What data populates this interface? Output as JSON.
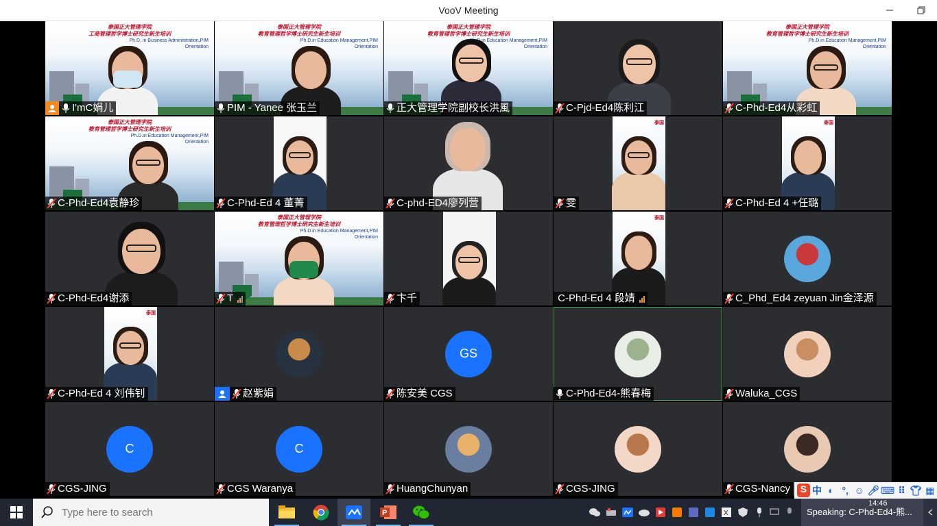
{
  "window": {
    "title": "VooV Meeting"
  },
  "participants": [
    {
      "name": "I'mC娟儿",
      "host": true
    },
    {
      "name": "PIM - Yanee 张玉兰"
    },
    {
      "name": "正大管理学院副校长洪風"
    },
    {
      "name": "C-Pjd-Ed4陈利江"
    },
    {
      "name": "C-Phd-Ed4从彩虹"
    },
    {
      "name": "C-Phd-Ed4袁静珍"
    },
    {
      "name": "C-Phd-Ed 4 董菁"
    },
    {
      "name": "C-phd-ED4廖列营"
    },
    {
      "name": "雯"
    },
    {
      "name": "C-Phd-Ed 4 +任璐"
    },
    {
      "name": "C-Phd-Ed4谢添"
    },
    {
      "name": "T"
    },
    {
      "name": "卞千"
    },
    {
      "name": "C-Phd-Ed 4 段婧"
    },
    {
      "name": "C_Phd_Ed4 zeyuan Jin金泽源"
    },
    {
      "name": "C-Phd-Ed 4 刘伟钊"
    },
    {
      "name": "赵紫娟"
    },
    {
      "name": "陈安美 CGS",
      "initials": "GS"
    },
    {
      "name": "C-Phd-Ed4-熊春梅"
    },
    {
      "name": "Waluka_CGS"
    },
    {
      "name": "CGS-JING",
      "initials": "C"
    },
    {
      "name": "CGS Waranya",
      "initials": "C"
    },
    {
      "name": "HuangChunyan"
    },
    {
      "name": "CGS-JING"
    },
    {
      "name": "CGS-Nancy"
    }
  ],
  "banner": {
    "line1": "泰国正大管理学院",
    "line2": "教育管理哲学博士研究生新生培训",
    "line2_alt": "工商管理哲学博士研究生新生培训",
    "en1": "Ph.D.in Education Management,PIM",
    "en1_alt": "Ph.D. in Business Administration,PIM",
    "en2": "Orientation"
  },
  "taskbar": {
    "search_placeholder": "Type here to search",
    "speaking": "Speaking: C-Phd-Ed4-熊...",
    "clock": "14:46"
  },
  "ime": {
    "mode": "中"
  },
  "colors": {
    "accent": "#1a73ff",
    "host": "#f48a1f",
    "active_border": "#3fbf5f",
    "tile_bg": "#2c2d30"
  }
}
